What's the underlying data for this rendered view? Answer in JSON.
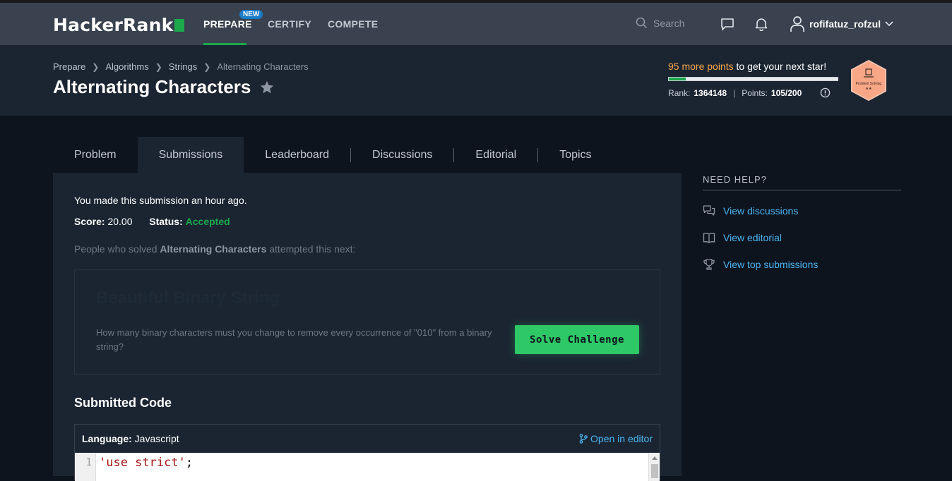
{
  "nav": {
    "logo": "HackerRank",
    "items": [
      {
        "label": "PREPARE",
        "badge": "NEW"
      },
      {
        "label": "CERTIFY"
      },
      {
        "label": "COMPETE"
      }
    ],
    "search_placeholder": "Search",
    "username": "rofifatuz_rofzul"
  },
  "breadcrumb": [
    "Prepare",
    "Algorithms",
    "Strings",
    "Alternating Characters"
  ],
  "page_title": "Alternating Characters",
  "progress": {
    "points_needed": "95 more points",
    "points_suffix": " to get your next star!",
    "fraction": 0.1,
    "rank_label": "Rank:",
    "rank": "1364148",
    "points_label": "Points:",
    "points": "105/200",
    "badge_label": "Problem Solving",
    "badge_stars": "★★"
  },
  "tabs": [
    "Problem",
    "Submissions",
    "Leaderboard",
    "Discussions",
    "Editorial",
    "Topics"
  ],
  "submission": {
    "made": "You made this submission an hour ago.",
    "score_label": "Score:",
    "score": "20.00",
    "status_label": "Status:",
    "status": "Accepted",
    "people_prefix": "People who solved ",
    "people_challenge": "Alternating Characters",
    "people_suffix": " attempted this next:"
  },
  "next_challenge": {
    "title": "Beautiful Binary String",
    "description": "How many binary characters must you change to remove every occurrence of \"010\" from a binary string?",
    "button": "Solve Challenge"
  },
  "code": {
    "heading": "Submitted Code",
    "language_label": "Language:",
    "language": "Javascript",
    "open_editor": "Open in editor",
    "line_number": "1",
    "line_string": "'use strict'",
    "line_punct": ";"
  },
  "help": {
    "title": "NEED HELP?",
    "items": [
      "View discussions",
      "View editorial",
      "View top submissions"
    ]
  },
  "colors": {
    "brand_green": "#1ba94c",
    "link_blue": "#4bb6f3",
    "accent_orange": "#f7a84a"
  }
}
